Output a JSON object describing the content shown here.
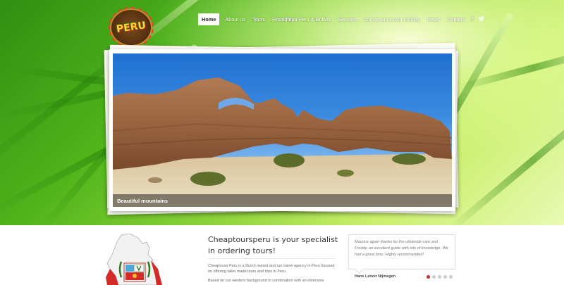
{
  "logo": {
    "text": "PERU"
  },
  "nav": {
    "items": [
      {
        "label": "Home",
        "active": true
      },
      {
        "label": "About us"
      },
      {
        "label": "Tours"
      },
      {
        "label": "Roundtrips Peru & Bolivia"
      },
      {
        "label": "Services"
      },
      {
        "label": "Create your own holiday"
      },
      {
        "label": "News"
      },
      {
        "label": "Contact"
      }
    ],
    "social": {
      "facebook": "f",
      "twitter": "t"
    }
  },
  "slider": {
    "caption": "Beautiful mountains"
  },
  "intro": {
    "heading": "Cheaptoursperu is your specialist in ordering tours!",
    "paragraph1": "Cheaptours Peru is a Dutch owned and run travel agency in Peru focused on offering tailer made tours and trips in Peru.",
    "paragraph2": "Based on our western background in combination with an extensive"
  },
  "testimonial": {
    "quote": "Maurice again thanks for the uitstende care and Freddy, an excellent guide with lots of knowledge. We had a great time. Highly recommended!",
    "author": "Hans Lenoir Nijmegen",
    "dots_total": 5,
    "dots_active": 1
  },
  "colors": {
    "accent": "#d62a2a",
    "nav_active_bg": "#ffffff"
  }
}
